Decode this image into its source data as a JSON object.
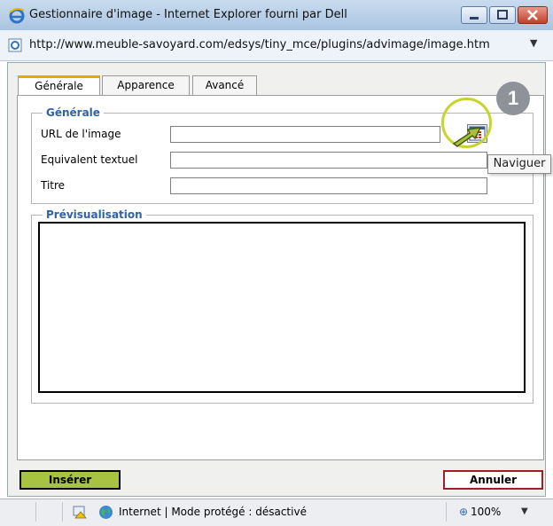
{
  "window": {
    "title": "Gestionnaire d'image - Internet Explorer fourni par Dell",
    "controls": [
      "minimize-icon",
      "maximize-icon",
      "close-icon"
    ]
  },
  "address": {
    "url": "http://www.meuble-savoyard.com/edsys/tiny_mce/plugins/advimage/image.htm"
  },
  "tabs": [
    {
      "label": "Générale",
      "active": true
    },
    {
      "label": "Apparence",
      "active": false
    },
    {
      "label": "Avancé",
      "active": false
    }
  ],
  "general": {
    "legend": "Générale",
    "url_label": "URL de l'image",
    "url_value": "",
    "alt_label": "Equivalent textuel",
    "alt_value": "",
    "title_label": "Titre",
    "title_value": "",
    "browse_icon": "browse-icon"
  },
  "preview": {
    "legend": "Prévisualisation"
  },
  "annotation": {
    "step": "1",
    "tooltip": "Naviguer"
  },
  "buttons": {
    "insert": "Insérer",
    "cancel": "Annuler"
  },
  "status": {
    "zone": "Internet | Mode protégé : désactivé",
    "zoom": "100%"
  },
  "colors": {
    "accent_tab": "#f4a000",
    "legend": "#2f62a9",
    "insert_bg": "#a8c241",
    "highlight": "#c6d42b",
    "badge": "#8f9399"
  }
}
